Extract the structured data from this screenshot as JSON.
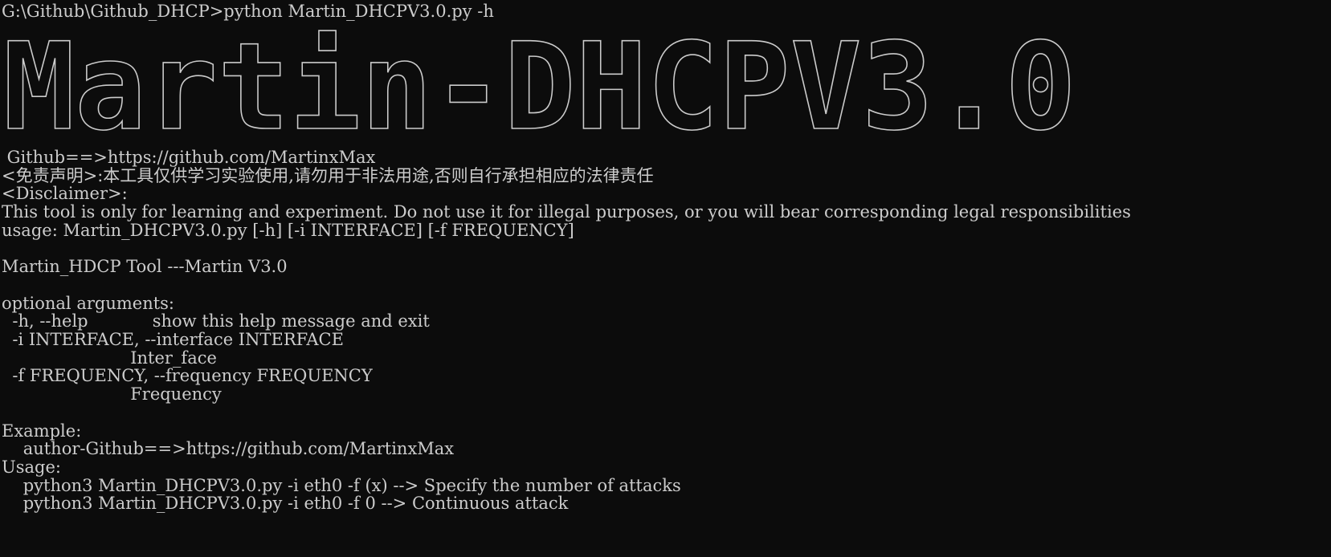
{
  "terminal": {
    "background": "#0c0c0c",
    "foreground": "#cccccc",
    "prompt": "G:\\Github\\Github_DHCP>",
    "command": "python Martin_DHCPV3.0.py -h",
    "banner": "Martin-DHCPV3.0",
    "lines": [
      " Github==>https://github.com/MartinxMax",
      "<免责声明>:本工具仅供学习实验使用,请勿用于非法用途,否则自行承担相应的法律责任",
      "<Disclaimer>:",
      "This tool is only for learning and experiment. Do not use it for illegal purposes, or you will bear corresponding legal responsibilities",
      "usage: Martin_DHCPV3.0.py [-h] [-i INTERFACE] [-f FREQUENCY]",
      "",
      "Martin_HDCP Tool ---Martin V3.0",
      "",
      "optional arguments:",
      "  -h, --help            show this help message and exit",
      "  -i INTERFACE, --interface INTERFACE",
      "                        Inter_face",
      "  -f FREQUENCY, --frequency FREQUENCY",
      "                        Frequency",
      "",
      "Example:",
      "    author-Github==>https://github.com/MartinxMax",
      "Usage:",
      "    python3 Martin_DHCPV3.0.py -i eth0 -f (x) --> Specify the number of attacks",
      "    python3 Martin_DHCPV3.0.py -i eth0 -f 0 --> Continuous attack"
    ]
  }
}
